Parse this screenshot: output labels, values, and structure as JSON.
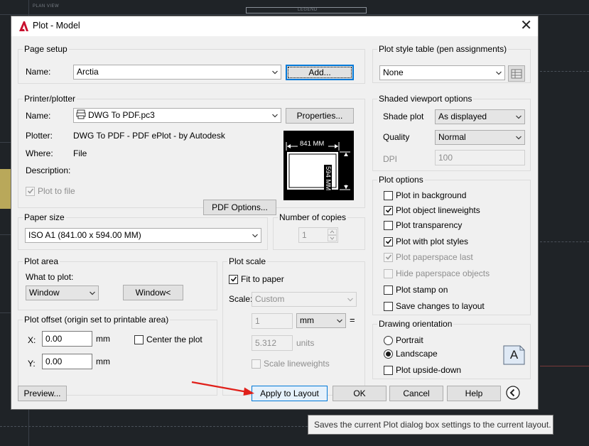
{
  "background": {
    "plan_view_label": "PLAN VIEW",
    "legend_label": "LEGEND"
  },
  "dialog": {
    "title": "Plot - Model",
    "close_symbol": "✕"
  },
  "page_setup": {
    "group_title": "Page setup",
    "name_label": "Name:",
    "name_value": "Arctia",
    "add_button": "Add..."
  },
  "printer": {
    "group_title": "Printer/plotter",
    "name_label": "Name:",
    "name_value": "DWG To PDF.pc3",
    "properties_button": "Properties...",
    "plotter_label": "Plotter:",
    "plotter_value": "DWG To PDF - PDF ePlot - by Autodesk",
    "where_label": "Where:",
    "where_value": "File",
    "description_label": "Description:",
    "plot_to_file_label": "Plot to file",
    "pdf_options_button": "PDF Options...",
    "preview_width": "841 MM",
    "preview_height": "594 MM"
  },
  "paper_size": {
    "group_title": "Paper size",
    "value": "ISO A1 (841.00 x 594.00 MM)"
  },
  "copies": {
    "group_title": "Number of copies",
    "value": "1"
  },
  "plot_area": {
    "group_title": "Plot area",
    "what_label": "What to plot:",
    "what_value": "Window",
    "window_button": "Window<"
  },
  "plot_offset": {
    "group_title": "Plot offset (origin set to printable area)",
    "x_label": "X:",
    "x_value": "0.00",
    "x_unit": "mm",
    "y_label": "Y:",
    "y_value": "0.00",
    "y_unit": "mm",
    "center_label": "Center the plot"
  },
  "plot_scale": {
    "group_title": "Plot scale",
    "fit_label": "Fit to paper",
    "scale_label": "Scale:",
    "scale_value": "Custom",
    "value1": "1",
    "unit_value": "mm",
    "equals": "=",
    "value2": "5.312",
    "units_label": "units",
    "scale_lineweights_label": "Scale lineweights"
  },
  "plot_style": {
    "group_title": "Plot style table (pen assignments)",
    "value": "None"
  },
  "shaded": {
    "group_title": "Shaded viewport options",
    "shade_label": "Shade plot",
    "shade_value": "As displayed",
    "quality_label": "Quality",
    "quality_value": "Normal",
    "dpi_label": "DPI",
    "dpi_value": "100"
  },
  "plot_options": {
    "group_title": "Plot options",
    "items": [
      {
        "label": "Plot in background"
      },
      {
        "label": "Plot object lineweights"
      },
      {
        "label": "Plot transparency"
      },
      {
        "label": "Plot with plot styles"
      },
      {
        "label": "Plot paperspace last"
      },
      {
        "label": "Hide paperspace objects"
      },
      {
        "label": "Plot stamp on"
      },
      {
        "label": "Save changes to layout"
      }
    ]
  },
  "orientation": {
    "group_title": "Drawing orientation",
    "portrait": "Portrait",
    "landscape": "Landscape",
    "upside_down": "Plot upside-down",
    "icon_letter": "A"
  },
  "footer": {
    "preview_button": "Preview...",
    "apply_button": "Apply to Layout",
    "ok_button": "OK",
    "cancel_button": "Cancel",
    "help_button": "Help"
  },
  "tooltip": {
    "text": "Saves the current Plot dialog box settings to the current layout."
  },
  "colors": {
    "dialog_bg": "#f0f0f0",
    "focus_blue": "#0078d7",
    "arrow_red": "#e0201a",
    "autocad_red": "#c8102e",
    "cad_bg": "#1f2327"
  }
}
